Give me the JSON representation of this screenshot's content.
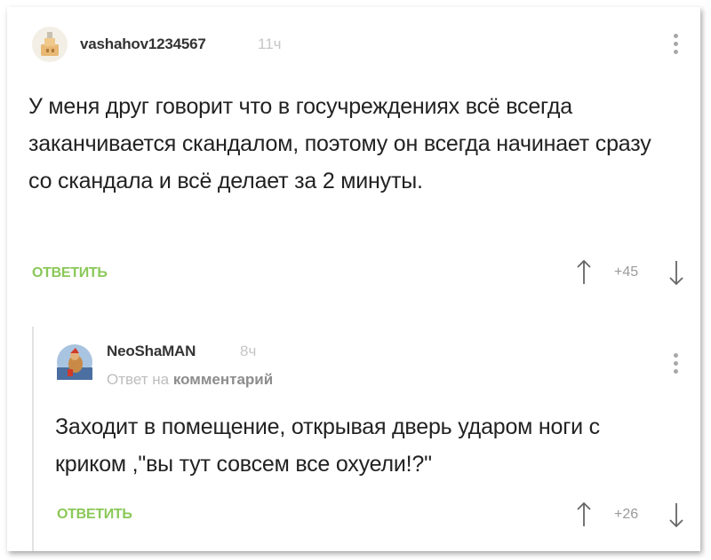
{
  "comment": {
    "username": "vashahov1234567",
    "time": "11ч",
    "text": "У меня друг говорит что в госучреждениях всё всегда заканчивается скандалом, поэтому он всегда начинает сразу со скандала и всё делает за 2 минуты.",
    "reply_label": "ОТВЕТИТЬ",
    "rating": "+45"
  },
  "reply": {
    "username": "NeoShaMAN",
    "time": "8ч",
    "reply_prefix": "Ответ на",
    "reply_target": "комментарий",
    "text": "Заходит в помещение, открывая дверь ударом ноги с криком ,\"вы тут совсем все охуели!?\"",
    "reply_label": "ОТВЕТИТЬ",
    "rating": "+26"
  },
  "icons": [
    "more-vertical-icon",
    "upvote-arrow-icon",
    "downvote-arrow-icon"
  ],
  "colors": {
    "reply_button": "#8ac858",
    "username": "#333333",
    "muted": "#c5c5c5"
  }
}
